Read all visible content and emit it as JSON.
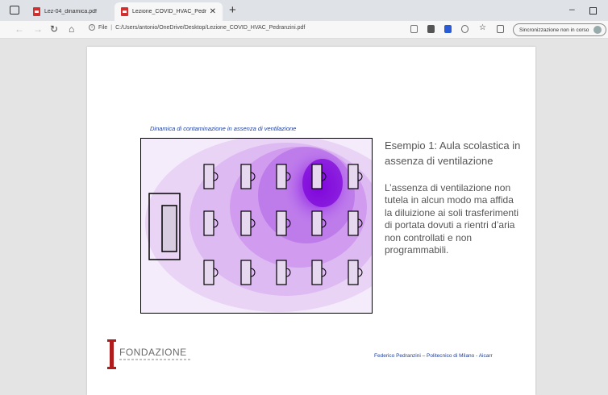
{
  "browser": {
    "tabs": [
      {
        "label": "Lez-04_dinamica.pdf",
        "active": false
      },
      {
        "label": "Lezione_COVID_HVAC_Pedranzi",
        "active": true
      }
    ],
    "new_tab": "+",
    "address": {
      "scheme_label": "File",
      "path": "C:/Users/antonio/OneDrive/Desktop/Lezione_COVID_HVAC_Pedranzini.pdf"
    },
    "sync_label": "Sincronizzazione non in corso",
    "icons": {
      "back": "back-arrow-icon",
      "forward": "forward-arrow-icon",
      "reload": "reload-icon",
      "home": "home-icon"
    },
    "colors": {
      "pdf_red": "#d32f2f",
      "tabstrip": "#dfe3e8"
    }
  },
  "slide": {
    "caption": "Dinamica di contaminazione in assenza di ventilazione",
    "title": "Esempio 1: Aula scolastica in assenza di ventilazione",
    "body": "L’assenza di ventilazione non tutela in alcun modo ma affida la diluizione ai soli trasferimenti di portata dovuti  a rientri d’aria non controllati e non programmabili.",
    "logo_text": "FONDAZIONE",
    "credit": "Federico Pedranzini – Politecnico di Milano - Aicarr",
    "colors": {
      "caption_blue": "#1f3f9a",
      "plume_purple": "#8a10e0",
      "logo_red": "#b01c1c"
    }
  }
}
